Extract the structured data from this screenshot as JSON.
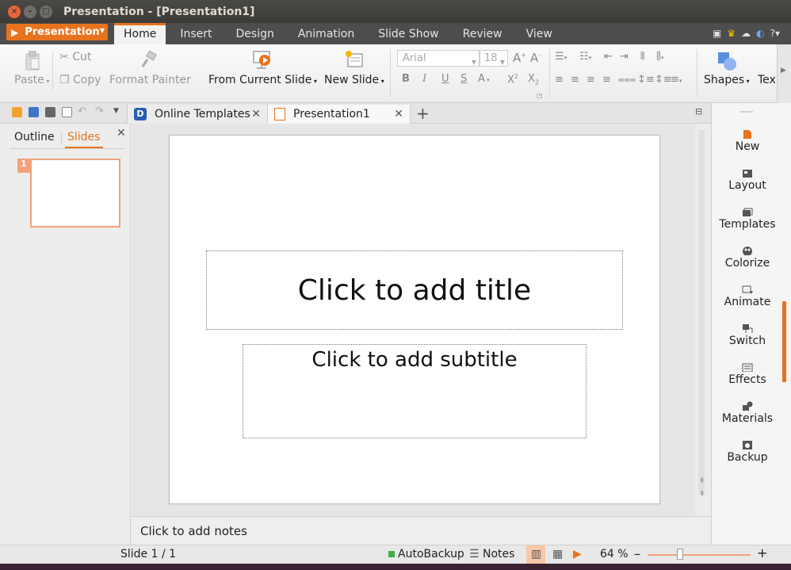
{
  "window": {
    "title": "Presentation - [Presentation1]"
  },
  "app_menu": {
    "label": "Presentation"
  },
  "menu_tabs": [
    "Home",
    "Insert",
    "Design",
    "Animation",
    "Slide Show",
    "Review",
    "View"
  ],
  "ribbon": {
    "paste": "Paste",
    "cut": "Cut",
    "copy": "Copy",
    "format_painter": "Format Painter",
    "from_current_slide": "From Current Slide",
    "new_slide": "New Slide",
    "font_name": "Arial",
    "font_size": "18",
    "shapes": "Shapes",
    "text": "Tex",
    "bold": "B",
    "italic": "I",
    "underline": "U",
    "shadow": "S",
    "font_color": "A"
  },
  "doc_tabs": [
    {
      "label": "Online Templates"
    },
    {
      "label": "Presentation1"
    }
  ],
  "left_panel": {
    "outline_tab": "Outline",
    "slides_tab": "Slides",
    "slide_number": "1"
  },
  "slide": {
    "title_placeholder": "Click to add title",
    "subtitle_placeholder": "Click to add subtitle"
  },
  "notes": {
    "placeholder": "Click to add notes"
  },
  "task_panel": [
    "New",
    "Layout",
    "Templates",
    "Colorize",
    "Animate",
    "Switch",
    "Effects",
    "Materials",
    "Backup"
  ],
  "status": {
    "slide_info": "Slide 1 / 1",
    "autobackup": "AutoBackup",
    "notes": "Notes",
    "zoom": "64 %"
  },
  "colors": {
    "accent": "#e8731e",
    "titlebar": "#3c3b37",
    "menubar": "#4d4d4d"
  }
}
